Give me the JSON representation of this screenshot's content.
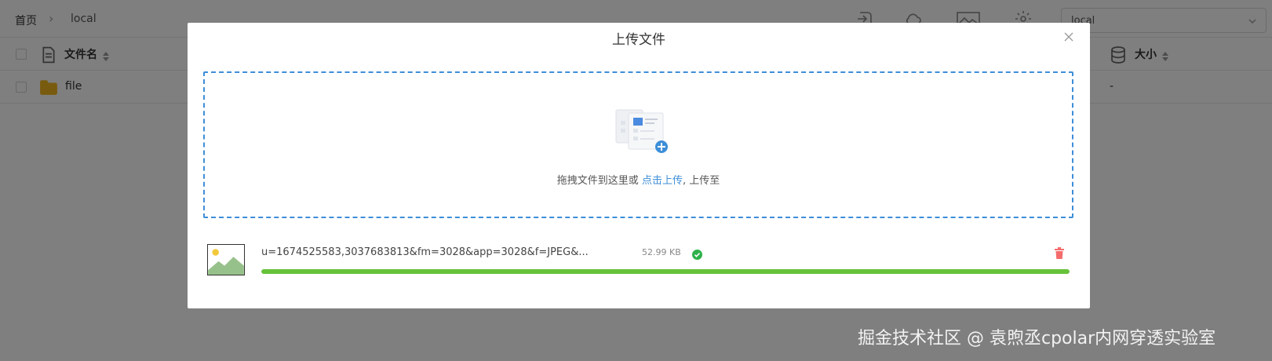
{
  "breadcrumb": {
    "home": "首页",
    "separator": "›",
    "current": "local"
  },
  "toolbar": {
    "icons": [
      "upload-icon",
      "cloud-icon",
      "gallery-icon",
      "settings-icon"
    ],
    "storage_select": {
      "value": "local"
    }
  },
  "table": {
    "columns": [
      "文件名",
      "大小"
    ],
    "rows": [
      {
        "name": "file",
        "size": "-",
        "type": "folder"
      }
    ]
  },
  "upload_dialog": {
    "title": "上传文件",
    "drop_text": "拖拽文件到这里或",
    "drop_link": "点击上传",
    "drop_suffix": ", 上传至",
    "file": {
      "name": "u=1674525583,3037683813&fm=3028&app=3028&f=JPEG&...",
      "size": "52.99 KB",
      "status": "success",
      "progress": 1.0
    },
    "colors": {
      "accent": "#3d8ed8",
      "progress": "#67c23a",
      "success": "#2fb24c",
      "delete": "#f56c6c"
    }
  },
  "watermark": "掘金技术社区 @ 袁煦丞cpolar内网穿透实验室"
}
